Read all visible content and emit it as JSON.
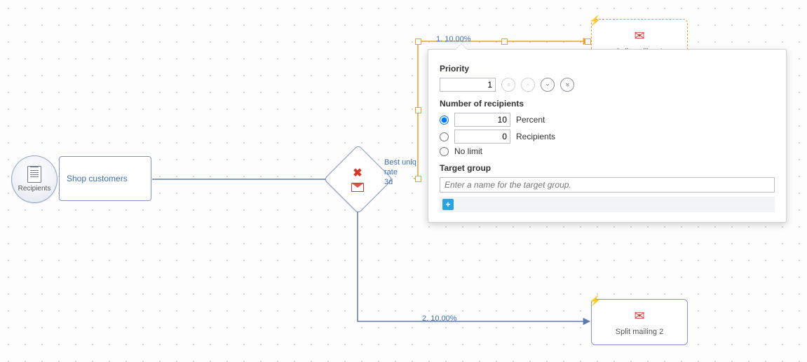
{
  "recipients": {
    "label": "Recipients"
  },
  "shop_node": {
    "label": "Shop customers"
  },
  "decision": {
    "label_line1": "Best uniq",
    "label_line2": "rate",
    "label_line3": "3d"
  },
  "edges": {
    "top": "1. 10.00%",
    "bottom": "2. 10.00%"
  },
  "mailing1": {
    "title": "Split mailing 1"
  },
  "mailing2": {
    "title": "Split mailing 2"
  },
  "popup": {
    "priority_label": "Priority",
    "priority_value": "1",
    "recipients_label": "Number of recipients",
    "percent_value": "10",
    "percent_text": "Percent",
    "recipients_value": "0",
    "recipients_text": "Recipients",
    "nolimit_text": "No limit",
    "target_label": "Target group",
    "target_placeholder": "Enter a name for the target group."
  }
}
